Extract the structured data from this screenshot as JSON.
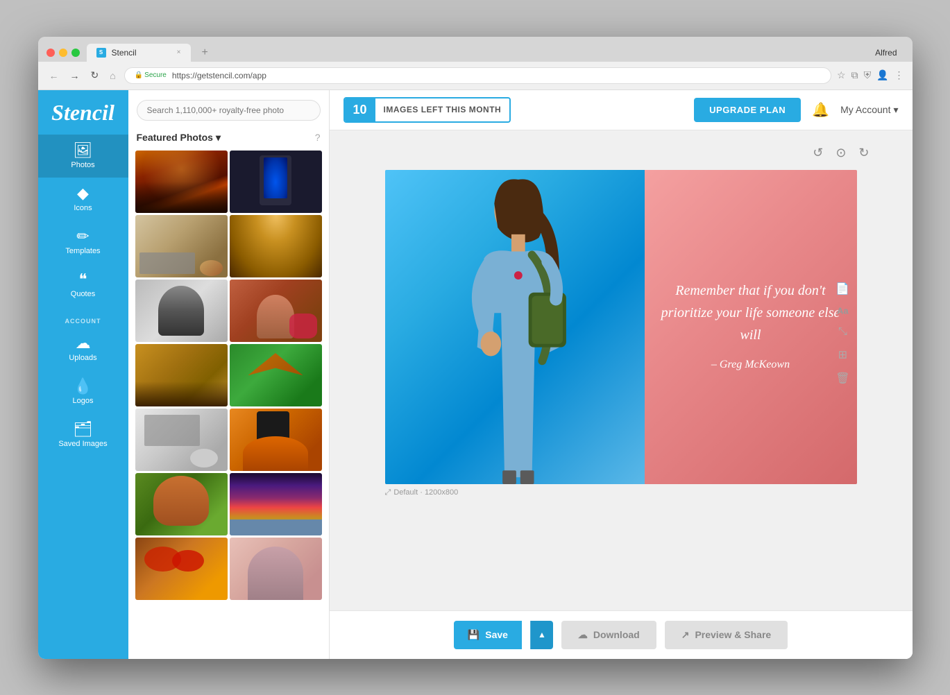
{
  "browser": {
    "tab_title": "Stencil",
    "url_secure": "Secure",
    "url": "https://getstencil.com/app",
    "user": "Alfred",
    "new_tab_label": "+"
  },
  "topbar": {
    "images_count": "10",
    "images_label": "IMAGES LEFT THIS MONTH",
    "upgrade_label": "UPGRADE PLAN",
    "account_label": "My Account"
  },
  "sidebar": {
    "logo": "Stencil",
    "nav_items": [
      {
        "id": "photos",
        "label": "Photos",
        "icon": "🖼"
      },
      {
        "id": "icons",
        "label": "Icons",
        "icon": "◆"
      },
      {
        "id": "templates",
        "label": "Templates",
        "icon": "✏"
      },
      {
        "id": "quotes",
        "label": "Quotes",
        "icon": "❝"
      }
    ],
    "account_label": "ACCOUNT",
    "account_items": [
      {
        "id": "uploads",
        "label": "Uploads",
        "icon": "☁"
      },
      {
        "id": "logos",
        "label": "Logos",
        "icon": "💧"
      },
      {
        "id": "saved",
        "label": "Saved Images",
        "icon": "🗂"
      }
    ]
  },
  "photos_panel": {
    "search_placeholder": "Search 1,110,000+ royalty-free photo",
    "section_title": "Featured Photos",
    "section_chevron": "▾",
    "help_icon": "?"
  },
  "canvas": {
    "undo_icon": "↺",
    "reset_icon": "⊙",
    "redo_icon": "↻",
    "quote": "Remember that if you don't prioritize your life someone else will",
    "attribution": "– Greg McKeown",
    "canvas_info": "Default · 1200x800",
    "expand_icon": "⤢"
  },
  "right_tools": {
    "file_icon": "📄",
    "text_icon": "Aa",
    "resize_icon": "⤡",
    "grid_icon": "⊞",
    "delete_icon": "🗑"
  },
  "bottom_bar": {
    "save_label": "Save",
    "save_icon": "💾",
    "caret": "▲",
    "download_label": "Download",
    "download_icon": "☁",
    "preview_label": "Preview & Share",
    "preview_icon": "↗"
  }
}
